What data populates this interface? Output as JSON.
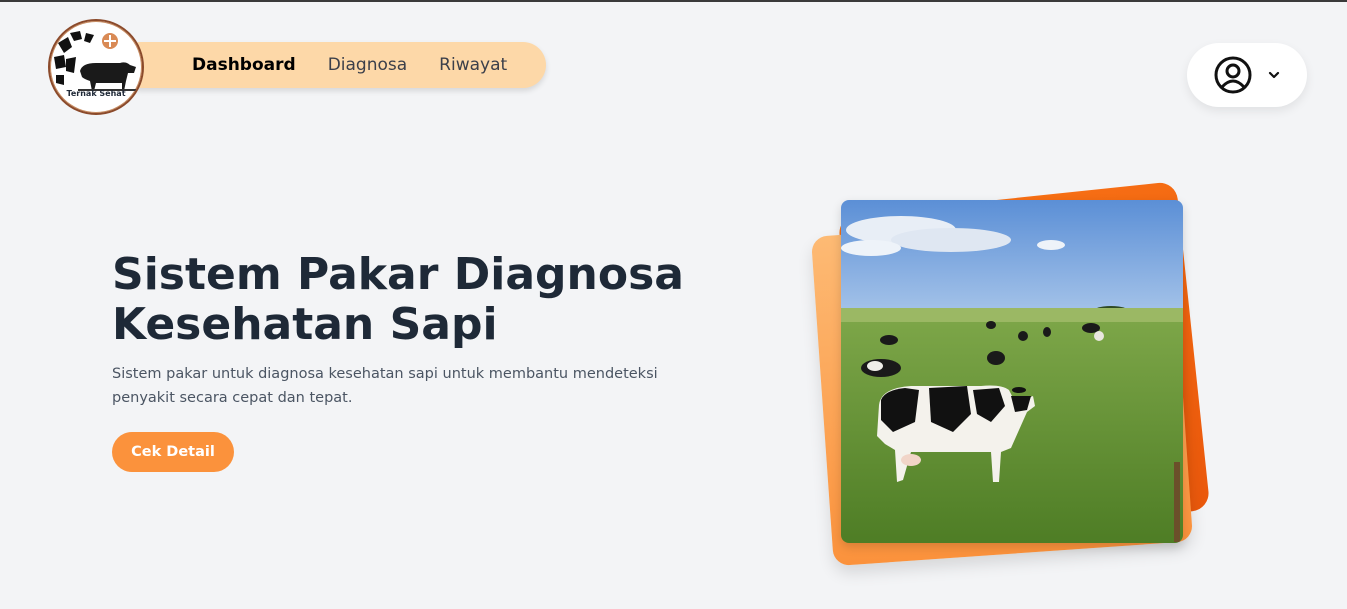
{
  "logo": {
    "text": "Ternak Sehat"
  },
  "nav": {
    "items": [
      {
        "label": "Dashboard",
        "active": true
      },
      {
        "label": "Diagnosa",
        "active": false
      },
      {
        "label": "Riwayat",
        "active": false
      }
    ]
  },
  "profile": {
    "icon": "user-circle-icon",
    "dropdown_icon": "chevron-down-icon"
  },
  "hero": {
    "title_line1": "Sistem Pakar Diagnosa",
    "title_line2": "Kesehatan Sapi",
    "description_line1": "Sistem pakar untuk diagnosa kesehatan sapi untuk membantu mendeteksi",
    "description_line2": "penyakit secara cepat dan tepat.",
    "cta_label": "Cek Detail"
  },
  "colors": {
    "accent": "#fb923c",
    "nav_bg": "#fdd8a8",
    "title": "#1e2937"
  }
}
